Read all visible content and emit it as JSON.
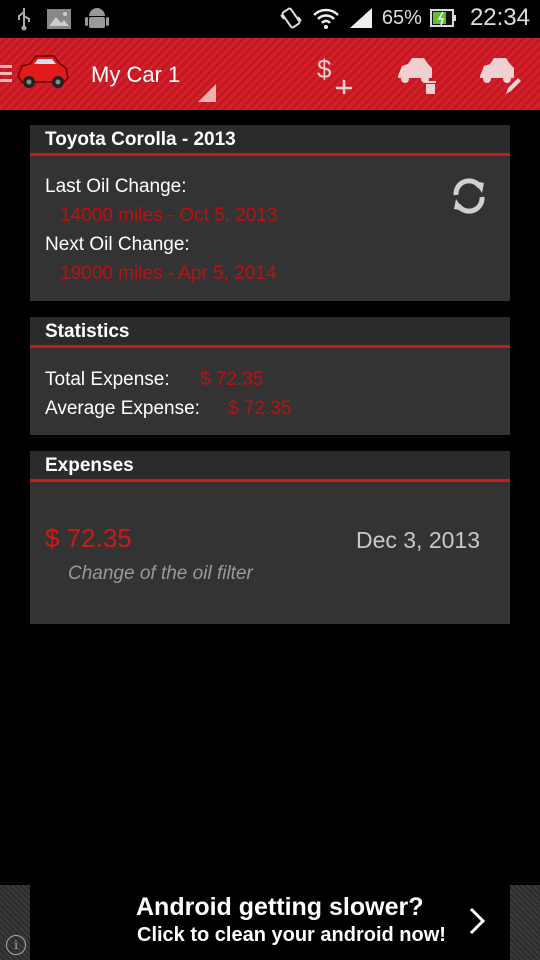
{
  "status_bar": {
    "battery_percent": "65%",
    "time": "22:34",
    "icons": [
      "usb-icon",
      "image-icon",
      "android-icon",
      "vibrate-icon",
      "wifi-icon",
      "signal-icon",
      "battery-icon"
    ]
  },
  "action_bar": {
    "title": "My Car 1",
    "actions": [
      "add-expense-icon",
      "delete-car-icon",
      "edit-car-icon"
    ],
    "accent": "#d5202b"
  },
  "car_card": {
    "title": "Toyota Corolla - 2013",
    "last_oil_label": "Last Oil Change:",
    "last_oil_value": "14000 miles - Oct 5, 2013",
    "next_oil_label": "Next Oil Change:",
    "next_oil_value": "19000 miles - Apr 5, 2014"
  },
  "stats_card": {
    "title": "Statistics",
    "total_label": "Total Expense:",
    "total_value": "$ 72.35",
    "avg_label": "Average Expense:",
    "avg_value": "$ 72.35"
  },
  "expenses_card": {
    "title": "Expenses",
    "items": [
      {
        "amount": "$ 72.35",
        "date": "Dec 3, 2013",
        "description": "Change of the oil filter"
      }
    ]
  },
  "ad": {
    "line1": "Android getting slower?",
    "line2": "Click to clean your android now!",
    "info": "i"
  },
  "colors": {
    "red_text": "#bb1111",
    "card_bg": "#333333",
    "divider": "#cc1b1b"
  }
}
